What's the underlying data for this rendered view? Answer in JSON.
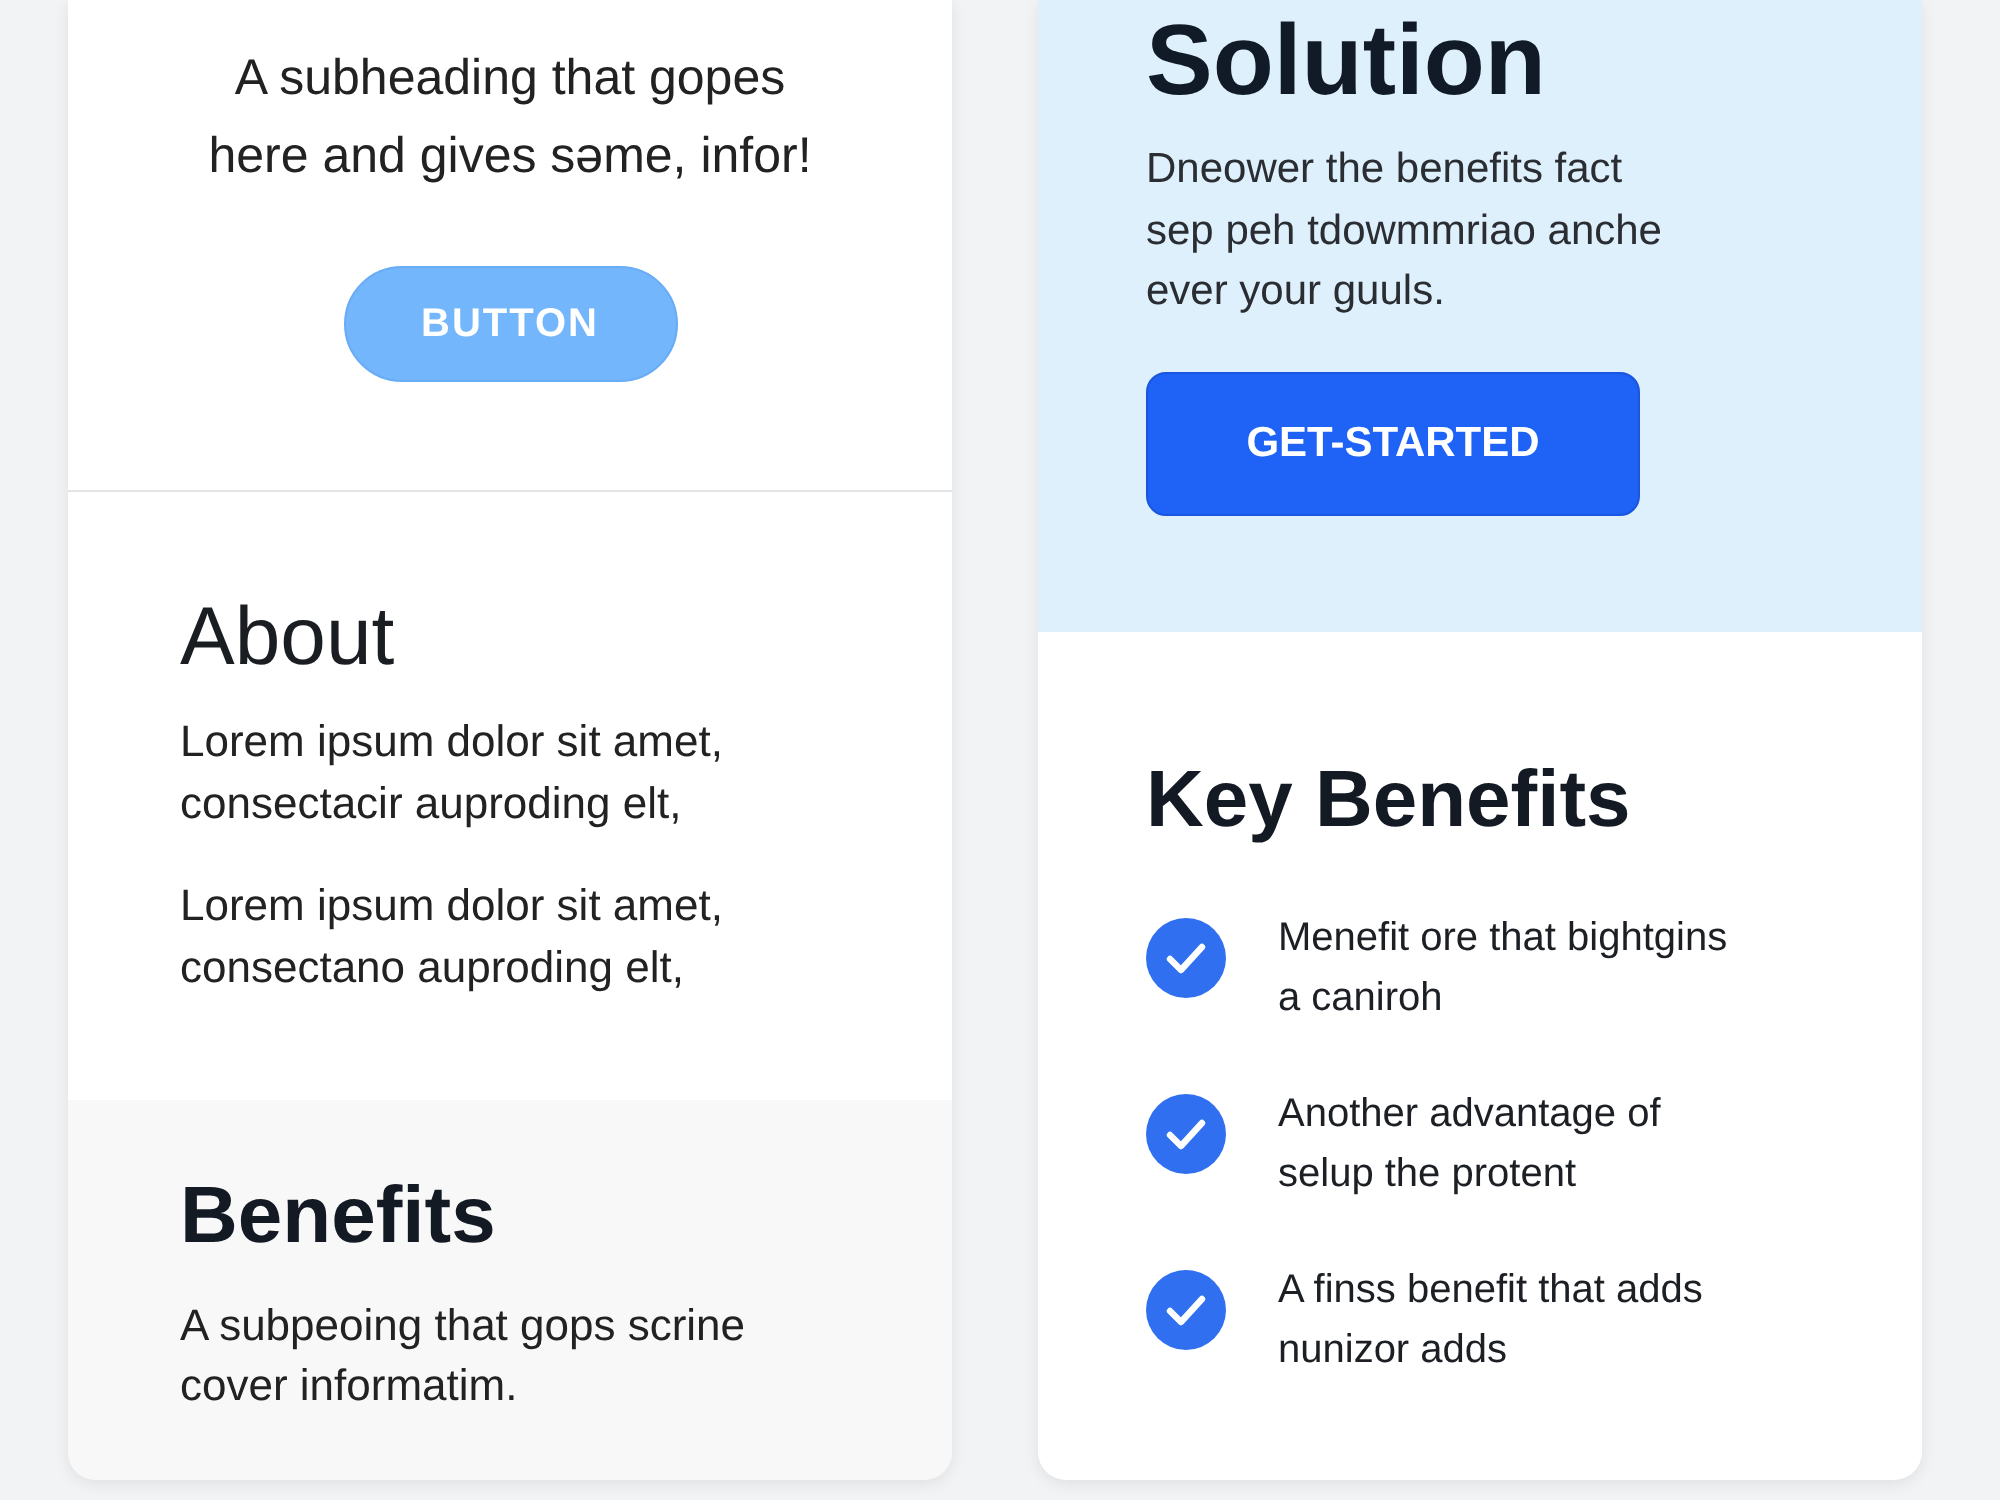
{
  "left_card": {
    "hero": {
      "subheading": "A subheading that gopes here and gives səme, infor!",
      "button": "BUTTON"
    },
    "about": {
      "title": "About",
      "paragraphs": [
        "Lorem ipsum dolor sit amet, consectacir auproding elt,",
        "Lorem ipsum dolor sit amet, consectano auproding elt,"
      ]
    },
    "benefits": {
      "title": "Benefits",
      "text": "A subpeoing that gops scrine cover informatim."
    }
  },
  "right_card": {
    "hero": {
      "title": "Solution",
      "text": "Dneower the benefits fact sep peh tdowmmriao anche ever your guuls.",
      "button": "GET-STARTED"
    },
    "key_benefits": {
      "title": "Key Benefits",
      "items": [
        {
          "text": "Menefit ore that bightgins a caniroh"
        },
        {
          "text": "Another advantage of selup the protent"
        },
        {
          "text": "A finss benefit that adds nunizor adds"
        }
      ]
    }
  }
}
